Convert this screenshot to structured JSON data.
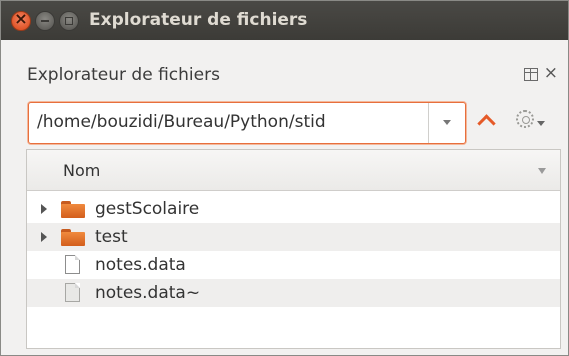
{
  "window": {
    "title": "Explorateur de fichiers"
  },
  "panel": {
    "title": "Explorateur de fichiers",
    "close_label": "×"
  },
  "path": {
    "value": "/home/bouzidi/Bureau/Python/stid"
  },
  "tree": {
    "column_header": "Nom",
    "items": [
      {
        "name": "gestScolaire",
        "kind": "folder",
        "icon": "folder-icon"
      },
      {
        "name": "test",
        "kind": "folder",
        "icon": "folder-icon"
      },
      {
        "name": "notes.data",
        "kind": "file",
        "icon": "file-icon"
      },
      {
        "name": "notes.data~",
        "kind": "backup-file",
        "icon": "file-icon"
      }
    ]
  },
  "colors": {
    "accent": "#e55a28",
    "titlebar": "#3c3b37"
  }
}
